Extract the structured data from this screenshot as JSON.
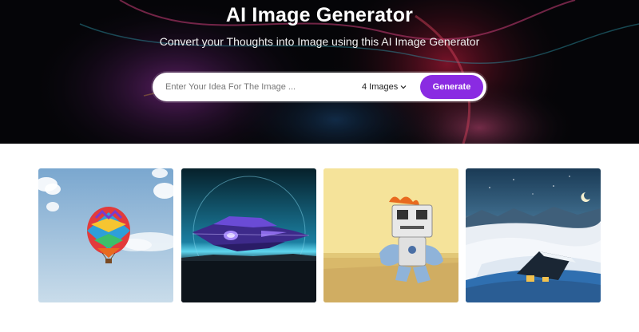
{
  "hero": {
    "title": "AI Image Generator",
    "subtitle": "Convert your Thoughts into Image using this AI Image Generator"
  },
  "search": {
    "placeholder": "Enter Your Idea For The Image ...",
    "value": "",
    "image_count": "4 Images",
    "generate_label": "Generate"
  },
  "colors": {
    "accent": "#8a2be2",
    "hero_background": "#07070b"
  },
  "gallery": {
    "images": [
      {
        "subject": "hot-air-balloon-in-sky"
      },
      {
        "subject": "purple-futuristic-spaceship"
      },
      {
        "subject": "toy-robot-sitting-against-yellow-wall"
      },
      {
        "subject": "snowy-cabin-night-landscape"
      }
    ]
  }
}
